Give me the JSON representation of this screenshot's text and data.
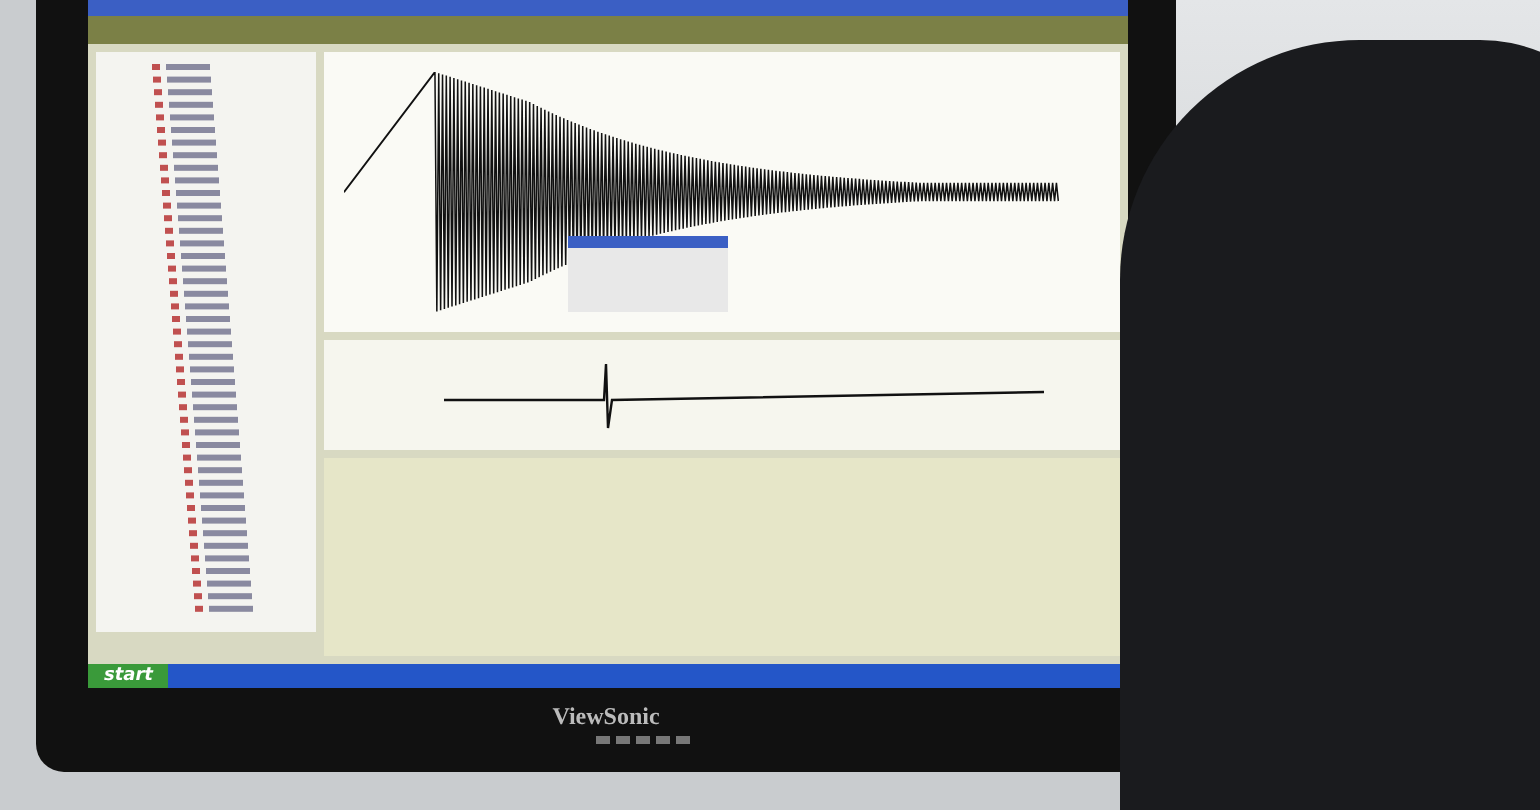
{
  "monitor": {
    "brand": "ViewSonic"
  },
  "taskbar": {
    "start_label": "start"
  }
}
